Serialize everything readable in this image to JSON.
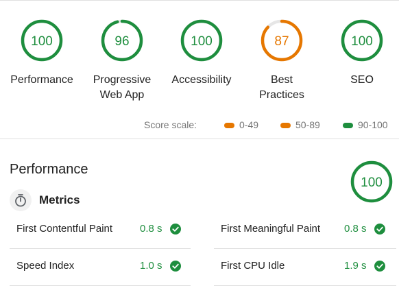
{
  "categories": [
    {
      "score": "100",
      "label_lines": [
        "Performance"
      ],
      "color": "#1e8e3e",
      "fraction": 1.0
    },
    {
      "score": "96",
      "label_lines": [
        "Progressive",
        "Web App"
      ],
      "color": "#1e8e3e",
      "fraction": 0.96
    },
    {
      "score": "100",
      "label_lines": [
        "Accessibility"
      ],
      "color": "#1e8e3e",
      "fraction": 1.0
    },
    {
      "score": "87",
      "label_lines": [
        "Best",
        "Practices"
      ],
      "color": "#e67700",
      "fraction": 0.87
    },
    {
      "score": "100",
      "label_lines": [
        "SEO"
      ],
      "color": "#1e8e3e",
      "fraction": 1.0
    }
  ],
  "score_scale": {
    "label": "Score scale:",
    "ranges": [
      {
        "text": "0-49",
        "color": "#e67700"
      },
      {
        "text": "50-89",
        "color": "#e67700"
      },
      {
        "text": "90-100",
        "color": "#1e8e3e"
      }
    ]
  },
  "performance_section": {
    "title": "Performance",
    "score": "100",
    "score_color": "#1e8e3e",
    "metrics_heading": "Metrics",
    "metrics_icon": "stopwatch-icon",
    "metrics": [
      {
        "name": "First Contentful Paint",
        "value": "0.8 s",
        "status_icon": "check-circle-icon",
        "color": "#1e8e3e"
      },
      {
        "name": "First Meaningful Paint",
        "value": "0.8 s",
        "status_icon": "check-circle-icon",
        "color": "#1e8e3e"
      },
      {
        "name": "Speed Index",
        "value": "1.0 s",
        "status_icon": "check-circle-icon",
        "color": "#1e8e3e"
      },
      {
        "name": "First CPU Idle",
        "value": "1.9 s",
        "status_icon": "check-circle-icon",
        "color": "#1e8e3e"
      }
    ]
  }
}
